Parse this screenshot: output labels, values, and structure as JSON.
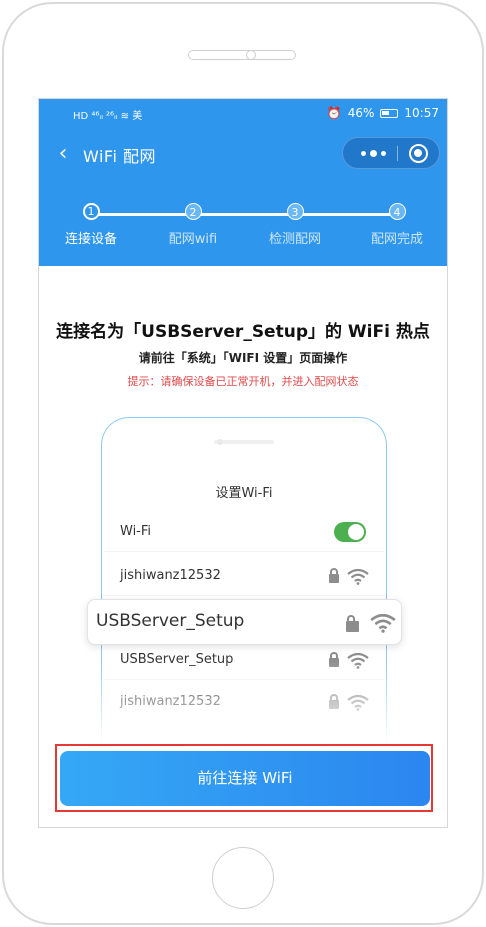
{
  "status_bar": {
    "left_indicators": "HD  ⁴⁶ᵢₗ  ²⁶ᵢₗ  ≋  美",
    "battery": "46%",
    "time": "10:57"
  },
  "nav": {
    "back_icon": "chevron-left-icon",
    "title": "WiFi 配网",
    "capsule_more_icon": "more-dots-icon",
    "capsule_close_icon": "target-circle-icon"
  },
  "steps": [
    {
      "number": "1",
      "label": "连接设备"
    },
    {
      "number": "2",
      "label": "配网wifi"
    },
    {
      "number": "3",
      "label": "检测配网"
    },
    {
      "number": "4",
      "label": "配网完成"
    }
  ],
  "content": {
    "title": "连接名为「USBServer_Setup」的 WiFi 热点",
    "subtitle": "请前往「系统」「WIFI 设置」页面操作",
    "tip": "提示：请确保设备已正常开机，并进入配网状态"
  },
  "illustration": {
    "settings_title": "设置Wi-Fi",
    "wifi_toggle_label": "Wi-Fi",
    "wifi_toggle_on": true,
    "networks": [
      {
        "name": "jishiwanz12532"
      },
      {
        "name": "USBServer_Setup"
      },
      {
        "name": "jishiwanz12532"
      }
    ],
    "highlighted_network": "USBServer_Setup"
  },
  "cta": {
    "label": "前往连接 WiFi"
  },
  "colors": {
    "primary": "#2f96ee",
    "tip_red": "#e24a4a",
    "toggle_green": "#4caf50",
    "highlight_outline": "#e53935"
  }
}
